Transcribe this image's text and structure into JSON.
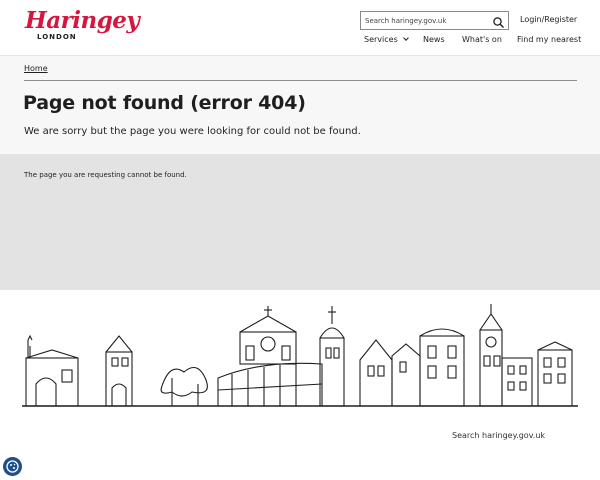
{
  "header": {
    "logo_text": "Haringey",
    "logo_sub": "LONDON",
    "search_placeholder": "Search haringey.gov.uk",
    "login_label": "Login/Register",
    "nav": {
      "services": "Services",
      "news": "News",
      "whats_on": "What's on",
      "find": "Find my nearest"
    }
  },
  "breadcrumb": {
    "home": "Home"
  },
  "page": {
    "title": "Page not found (error 404)",
    "intro": "We are sorry but the page you were looking for could not be found.",
    "message": "The page you are requesting cannot be found."
  },
  "footer": {
    "search_link": "Search haringey.gov.uk"
  },
  "colors": {
    "brand_red": "#d6163f",
    "text": "#1f1f1f",
    "hero_bg": "#f7f7f7",
    "band_bg": "#e3e3e3",
    "cookie_bg": "#1f4e8c"
  }
}
